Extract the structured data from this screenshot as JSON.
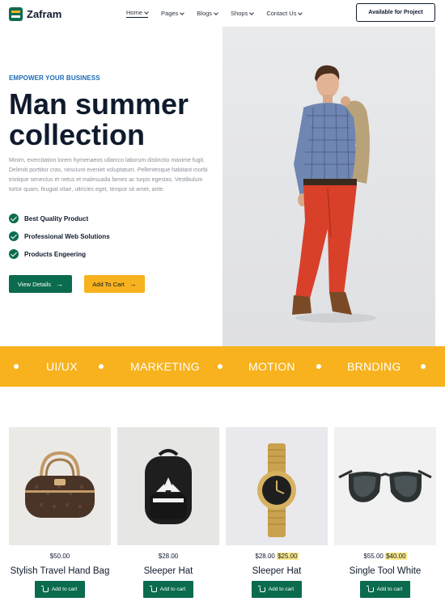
{
  "brand": {
    "name": "Zafram"
  },
  "nav": {
    "items": [
      {
        "label": "Home"
      },
      {
        "label": "Pages"
      },
      {
        "label": "Blogs"
      },
      {
        "label": "Shops"
      },
      {
        "label": "Contact Us"
      }
    ],
    "cta_label": "Available for Project"
  },
  "hero": {
    "eyebrow": "EMPOWER YOUR BUSINESS",
    "title_line1": "Man summer",
    "title_line2": "collection",
    "description": "Minim, exercitation lorem hymenaeos ullamco laborum distinctio maxime fugit. Deleniti porttitor cras, nesciunt eveniet voluptatum. Pellentesque habitant morbi tristique senectus et netus et malesuada fames ac turpis egestas. Vestibulum tortor quam, feugiat vitae, ultricies eget, tempor sit amet, ante.",
    "features": [
      {
        "label": "Best Quality Product"
      },
      {
        "label": "Professional Web Solutions"
      },
      {
        "label": "Products Engeering"
      }
    ],
    "primary_button": "View Details",
    "secondary_button": "Add To Cart"
  },
  "band": {
    "words": [
      "UI/UX",
      "MARKETING",
      "MOTION",
      "BRNDING"
    ]
  },
  "products": [
    {
      "name": "Stylish Travel Hand Bag",
      "price": "$50.00",
      "sale_price": "",
      "button": "Add to cart"
    },
    {
      "name": "Sleeper Hat",
      "price": "$28.00",
      "sale_price": "",
      "button": "Add to cart"
    },
    {
      "name": "Sleeper Hat",
      "price": "$28.00",
      "sale_price": "$25.00",
      "button": "Add to cart"
    },
    {
      "name": "Single Tool White",
      "price": "$55.00",
      "sale_price": "$40.00",
      "button": "Add to cart"
    }
  ],
  "colors": {
    "brand_green": "#0b6b4f",
    "accent_yellow": "#f7b21e",
    "eyebrow_blue": "#1b6ab5",
    "heading": "#0f1b2d"
  }
}
